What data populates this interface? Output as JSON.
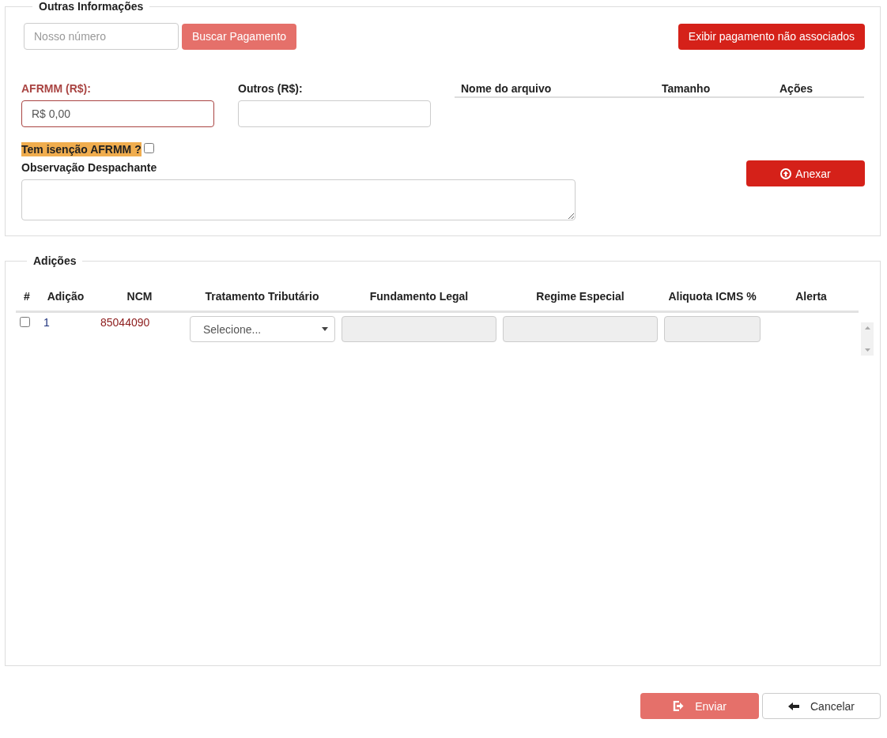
{
  "outras": {
    "legend": "Outras Informações",
    "nosso_numero": {
      "placeholder": "Nosso número"
    },
    "buscar_button": {
      "label": "Buscar Pagamento",
      "disabled": true
    },
    "exibir_button": {
      "label": "Exibir pagamento não associados",
      "disabled": false
    },
    "afrmm": {
      "label": "AFRMM (R$):",
      "value": "R$ 0,00",
      "invalid": true
    },
    "outros": {
      "label": "Outros (R$):",
      "invalid": false
    },
    "isencao": {
      "label": "Tem isenção AFRMM ?",
      "checked": false,
      "highlighted": true
    },
    "observacao": {
      "label": "Observação Despachante"
    },
    "files_table": {
      "columns": [
        "Nome do arquivo",
        "Tamanho",
        "Ações"
      ]
    },
    "anexar_button": {
      "label": "Anexar",
      "disabled": false
    }
  },
  "adicoes": {
    "legend": "Adições",
    "columns": [
      "#",
      "Adição",
      "NCM",
      "Tratamento Tributário",
      "Fundamento Legal",
      "Regime Especial",
      "Aliquota ICMS %",
      "Alerta"
    ],
    "rows": [
      {
        "checked": false,
        "adicao": "1",
        "ncm": "85044090",
        "tratamento": "Selecione..."
      }
    ]
  },
  "actions": [
    {
      "label": "Enviar",
      "kind": "submit",
      "disabled": true
    },
    {
      "label": "Cancelar",
      "kind": "cancel",
      "disabled": false
    }
  ]
}
